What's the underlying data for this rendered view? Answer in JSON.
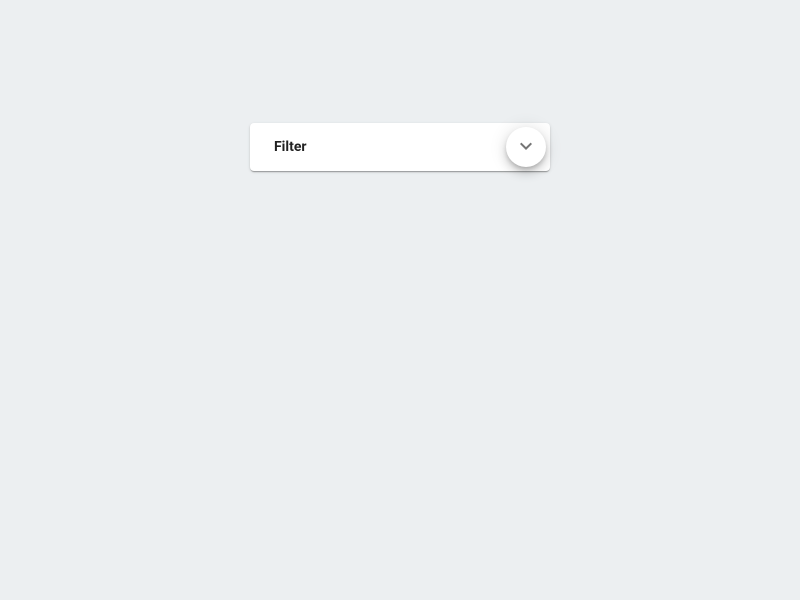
{
  "filter": {
    "title": "Filter",
    "toggle_label": "Toggle expand"
  }
}
